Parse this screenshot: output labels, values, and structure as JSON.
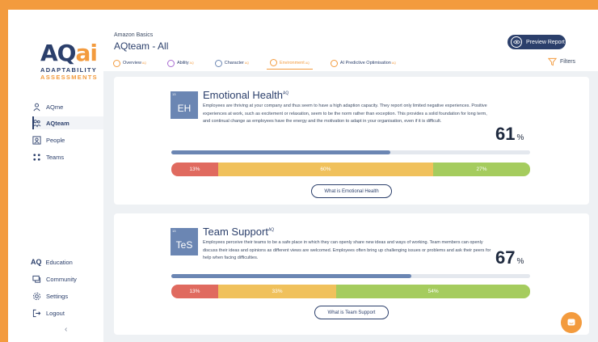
{
  "brand": {
    "logo_main": "AQ",
    "logo_ai": "ai",
    "logo_sub1": "ADAPTABILITY",
    "logo_sub2": "ASSESSMENTS"
  },
  "sidebar": {
    "items": [
      {
        "label": "AQme",
        "icon": "person-icon"
      },
      {
        "label": "AQteam",
        "icon": "team-icon"
      },
      {
        "label": "People",
        "icon": "people-icon"
      },
      {
        "label": "Teams",
        "icon": "teams-icon"
      }
    ],
    "bottom": [
      {
        "label": "Education",
        "prefix": "AQ"
      },
      {
        "label": "Community",
        "icon": "chat-icon"
      },
      {
        "label": "Settings",
        "icon": "gear-icon"
      },
      {
        "label": "Logout",
        "icon": "logout-icon"
      }
    ],
    "collapse": "‹"
  },
  "header": {
    "company": "Amazon Basics",
    "title": "AQteam - All",
    "preview_label": "Preview Report",
    "filters_label": "Filters"
  },
  "tabs": [
    {
      "label": "Overview",
      "sup": "AQ"
    },
    {
      "label": "Ability",
      "sup": "AQ"
    },
    {
      "label": "Character",
      "sup": "AQ"
    },
    {
      "label": "Environment",
      "sup": "AQ",
      "active": true
    },
    {
      "label": "AI Predictive Optimisation",
      "sup": "AQ"
    }
  ],
  "cards": [
    {
      "index": "13",
      "abbr": "EH",
      "title": "Emotional Health",
      "title_sup": "AQ",
      "description": "Employees are thriving at your company and thus seem to have a high adaption capacity. They report only limited negative experiences. Positive experiences at work, such as excitement or relaxation, seem to be the norm rather than exception. This provides a solid foundation for long term, and continual change as employees have the energy and the motivation to adapt in your organisation, even if it is difficult.",
      "score": "61",
      "score_unit": "%",
      "progress": 0.61,
      "distribution": [
        {
          "label": "13%",
          "value": 13
        },
        {
          "label": "60%",
          "value": 60
        },
        {
          "label": "27%",
          "value": 27
        }
      ],
      "button": "What is Emotional Health"
    },
    {
      "index": "13",
      "abbr": "TeS",
      "title": "Team Support",
      "title_sup": "AQ",
      "description": "Employees perceive their teams to be a safe place in which they can openly share new ideas and ways of working. Team members can openly discuss their ideas and opinions as different views are welcomed. Employees often bring up challenging issues or problems and ask their peers for help when facing difficulties.",
      "score": "67",
      "score_unit": "%",
      "progress": 0.67,
      "distribution": [
        {
          "label": "13%",
          "value": 13
        },
        {
          "label": "33%",
          "value": 33
        },
        {
          "label": "54%",
          "value": 54
        }
      ],
      "button": "What is Team Support"
    }
  ],
  "colors": {
    "brand_navy": "#2b3f6b",
    "brand_orange": "#f39b3e",
    "red": "#e06a5f",
    "yellow": "#f0c15c",
    "green": "#a5cc5e"
  }
}
